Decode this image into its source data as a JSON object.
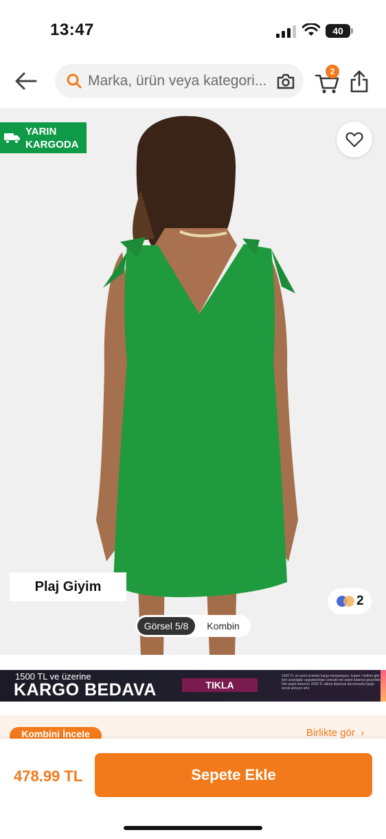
{
  "status_bar": {
    "time": "13:47",
    "battery": "40"
  },
  "header": {
    "search_placeholder": "Marka, ürün veya kategori...",
    "cart_count": "2",
    "icons": [
      "back-arrow-icon",
      "search-icon",
      "camera-icon",
      "cart-icon",
      "share-icon"
    ]
  },
  "product_image": {
    "cargo_badge": "YARIN\nKARGODA",
    "category_tag": "Plaj Giyim",
    "color_variant_count": "2",
    "gallery_label": "Görsel 5/8",
    "combine_label": "Kombin",
    "dress_color": "#1f9a3e"
  },
  "promo_banner": {
    "small_text": "1500 TL ve üzerine",
    "big_text": "KARGO BEDAVA",
    "cta": "TIKLA",
    "fine_print": "1500 TL ve üzeri ücretsiz kargo kampanyası, kupon / indirim gibi tüm avantajlar uygulandıktan sonraki net sepet tutarına geçerlidir. Net sepet tutarının 1500 TL altına düşmesi durumunda kargo ücreti alınıyor artır."
  },
  "combo_strip": {
    "tag": "Kombini İncele",
    "link": "Birlikte gör"
  },
  "bottom_bar": {
    "price": "478.99 TL",
    "add_to_cart": "Sepete Ekle"
  },
  "colors": {
    "brand_orange": "#f27a1a",
    "cargo_green": "#0e9a47"
  }
}
